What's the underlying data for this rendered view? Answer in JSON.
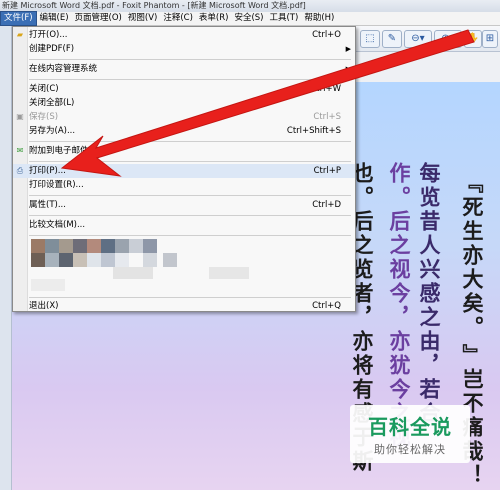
{
  "window": {
    "title": "新建 Microsoft Word 文档.pdf - Foxit Phantom - [新建 Microsoft Word 文档.pdf]"
  },
  "menubar": [
    "文件(F)",
    "编辑(E)",
    "页面管理(O)",
    "视图(V)",
    "注释(C)",
    "表单(R)",
    "安全(S)",
    "工具(T)",
    "帮助(H)"
  ],
  "file_menu": {
    "open": {
      "label": "打开(O)...",
      "shortcut": "Ctrl+O"
    },
    "create_pdf": {
      "label": "创建PDF(F)"
    },
    "online_content": {
      "label": "在线内容管理系统"
    },
    "close": {
      "label": "关闭(C)",
      "shortcut": "Ctrl+W"
    },
    "close_all": {
      "label": "关闭全部(L)"
    },
    "save": {
      "label": "保存(S)",
      "shortcut": "Ctrl+S"
    },
    "save_as": {
      "label": "另存为(A)...",
      "shortcut": "Ctrl+Shift+S"
    },
    "attach_email": {
      "label": "附加到电子邮件"
    },
    "print": {
      "label": "打印(P)...",
      "shortcut": "Ctrl+P"
    },
    "print_setup": {
      "label": "打印设置(R)..."
    },
    "properties": {
      "label": "属性(T)...",
      "shortcut": "Ctrl+D"
    },
    "compare": {
      "label": "比较文档(M)..."
    },
    "exit": {
      "label": "退出(X)",
      "shortcut": "Ctrl+Q"
    }
  },
  "document": {
    "columns": [
      {
        "text": "『死生亦大矣。",
        "color": "#1c1c1c"
      },
      {
        "text": "』岂不痛哉！",
        "color": "#1c1c1c"
      },
      {
        "text": "每览昔人兴感之由，若合",
        "color": "#3a2a6a"
      },
      {
        "text": "作。后之视今，亦犹今之视",
        "color": "#6b3fa0"
      },
      {
        "text": "也。后之览者，亦将有感于斯",
        "color": "#1c1c1c"
      }
    ]
  },
  "watermark": {
    "title": "百科全说",
    "subtitle": "助你轻松解决"
  },
  "colors": {
    "accent": "#3b6fb5",
    "arrow": "#e8201c",
    "watermark_green": "#1a9a5e"
  }
}
